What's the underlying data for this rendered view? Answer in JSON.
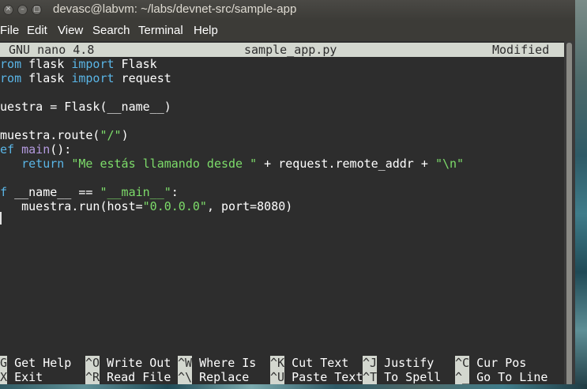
{
  "window": {
    "title": "devasc@labvm: ~/labs/devnet-src/sample-app",
    "close_glyph": "✕",
    "minimize_glyph": "–",
    "maximize_glyph": "□"
  },
  "menu": [
    "File",
    "Edit",
    "View",
    "Search",
    "Terminal",
    "Help"
  ],
  "nano": {
    "version": "GNU nano 4.8",
    "filename": "sample_app.py",
    "status": "Modified"
  },
  "code": {
    "l1_kw1": "from",
    "l1_mid": " flask ",
    "l1_kw2": "import",
    "l1_end": " Flask",
    "l2_kw1": "from",
    "l2_mid": " flask ",
    "l2_kw2": "import",
    "l2_end": " request",
    "l4": "muestra = Flask(__name__)",
    "l6_a": "@muestra.route(",
    "l6_str": "\"/\"",
    "l6_b": ")",
    "l7_kw": "def",
    "l7_sp": " ",
    "l7_fn": "main",
    "l7_b": "():",
    "l8_indent": "    ",
    "l8_kw": "return",
    "l8_sp": " ",
    "l8_str1": "\"Me estás llamando desde \"",
    "l8_mid": " + request.remote_addr + ",
    "l8_str2": "\"\\n\"",
    "l10_kw": "if",
    "l10_mid": " __name__ == ",
    "l10_str": "\"__main__\"",
    "l10_end": ":",
    "l11_a": "    muestra.run(host=",
    "l11_str": "\"0.0.0.0\"",
    "l11_b": ", port=8080)"
  },
  "shortcuts": [
    {
      "key": "^G",
      "label": " Get Help"
    },
    {
      "key": "^O",
      "label": " Write Out"
    },
    {
      "key": "^W",
      "label": " Where Is"
    },
    {
      "key": "^K",
      "label": " Cut Text"
    },
    {
      "key": "^J",
      "label": " Justify"
    },
    {
      "key": "^C",
      "label": " Cur Pos"
    },
    {
      "key": "^X",
      "label": " Exit"
    },
    {
      "key": "^R",
      "label": " Read File"
    },
    {
      "key": "^\\",
      "label": " Replace"
    },
    {
      "key": "^U",
      "label": " Paste Text"
    },
    {
      "key": "^T",
      "label": " To Spell"
    },
    {
      "key": "^_",
      "label": " Go To Line"
    }
  ]
}
